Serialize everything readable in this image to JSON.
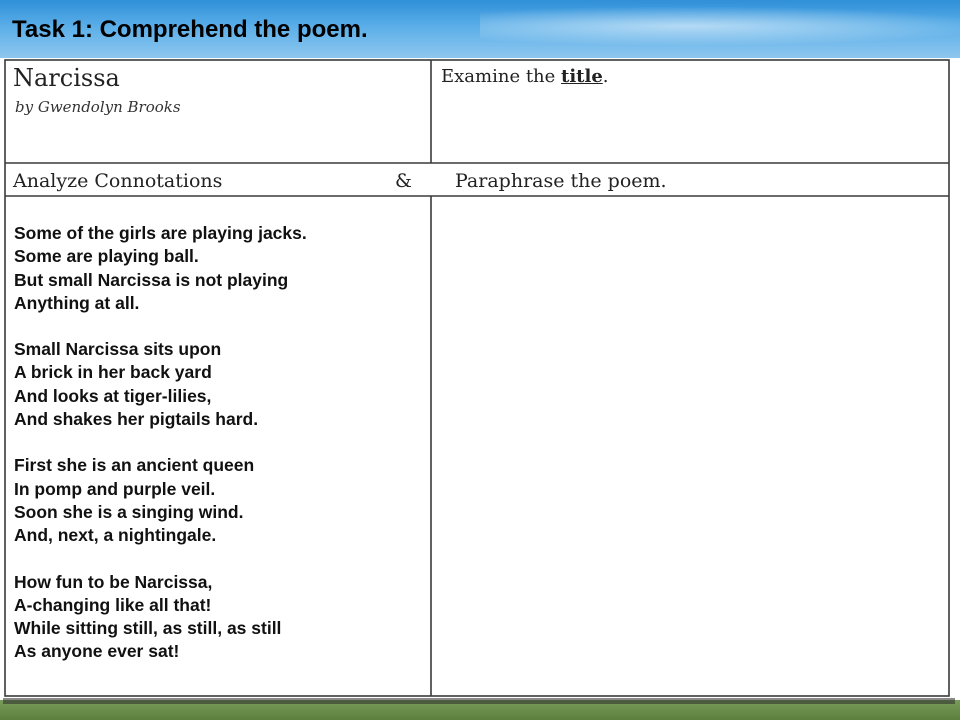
{
  "header": {
    "task_title": "Task 1:  Comprehend the poem."
  },
  "worksheet": {
    "poem_title": "Narcissa",
    "author": "by Gwendolyn Brooks",
    "examine_prefix": "Examine the ",
    "examine_emphasis": "title",
    "examine_suffix": ".",
    "analyze_label": "Analyze Connotations",
    "ampersand": "&",
    "paraphrase_label": "Paraphrase the poem."
  },
  "poem": {
    "stanzas": [
      [
        "Some of the girls are playing jacks.",
        "Some are playing ball.",
        "But small Narcissa is not playing",
        "Anything at all."
      ],
      [
        "Small Narcissa sits upon",
        "A brick in her back yard",
        "And looks at tiger-lilies,",
        "And shakes her pigtails hard."
      ],
      [
        "First she is an ancient queen",
        "In pomp and purple veil.",
        "Soon she is a singing wind.",
        "And, next, a nightingale."
      ],
      [
        "How fun to be Narcissa,",
        "A-changing like all that!",
        "While sitting still, as still, as still",
        "As anyone ever sat!"
      ]
    ]
  }
}
